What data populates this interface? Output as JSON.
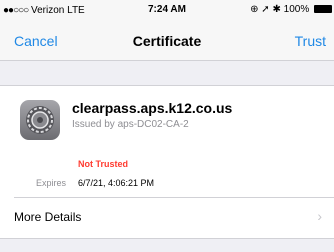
{
  "status": {
    "carrier": "Verizon",
    "network": "LTE",
    "time": "7:24 AM",
    "battery": "100%"
  },
  "nav": {
    "cancel_label": "Cancel",
    "title": "Certificate",
    "trust_label": "Trust"
  },
  "certificate": {
    "icon": "settings-gear-icon",
    "name": "clearpass.aps.k12.co.us",
    "issuer": "Issued by aps-DC02-CA-2",
    "trust_status": "Not Trusted",
    "expires_label": "Expires",
    "expires_value": "6/7/21, 4:06:21 PM"
  },
  "more_details": {
    "label": "More Details"
  },
  "colors": {
    "accent": "#1f88e5",
    "warning": "#ff3b30",
    "background": "#efeff4"
  }
}
